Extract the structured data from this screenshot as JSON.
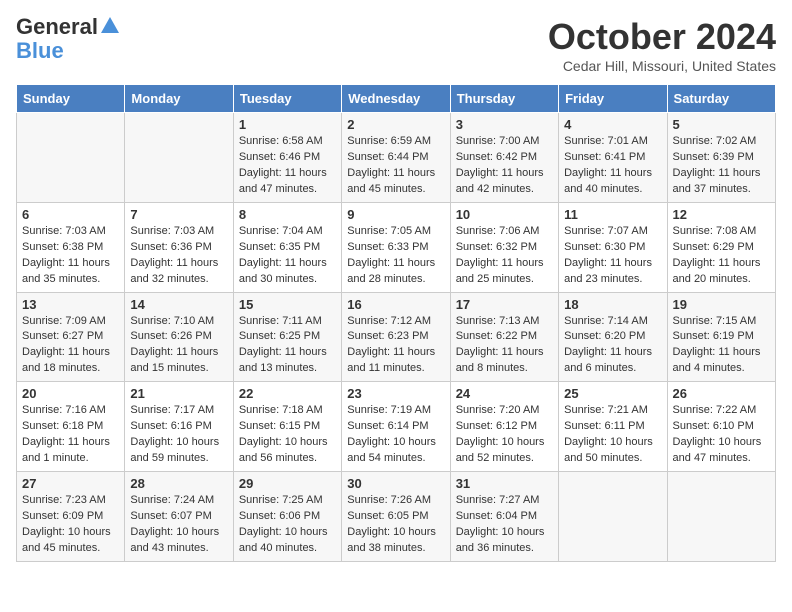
{
  "header": {
    "logo_general": "General",
    "logo_blue": "Blue",
    "month_title": "October 2024",
    "location": "Cedar Hill, Missouri, United States"
  },
  "days_of_week": [
    "Sunday",
    "Monday",
    "Tuesday",
    "Wednesday",
    "Thursday",
    "Friday",
    "Saturday"
  ],
  "weeks": [
    [
      {
        "day": "",
        "info": ""
      },
      {
        "day": "",
        "info": ""
      },
      {
        "day": "1",
        "info": "Sunrise: 6:58 AM\nSunset: 6:46 PM\nDaylight: 11 hours and 47 minutes."
      },
      {
        "day": "2",
        "info": "Sunrise: 6:59 AM\nSunset: 6:44 PM\nDaylight: 11 hours and 45 minutes."
      },
      {
        "day": "3",
        "info": "Sunrise: 7:00 AM\nSunset: 6:42 PM\nDaylight: 11 hours and 42 minutes."
      },
      {
        "day": "4",
        "info": "Sunrise: 7:01 AM\nSunset: 6:41 PM\nDaylight: 11 hours and 40 minutes."
      },
      {
        "day": "5",
        "info": "Sunrise: 7:02 AM\nSunset: 6:39 PM\nDaylight: 11 hours and 37 minutes."
      }
    ],
    [
      {
        "day": "6",
        "info": "Sunrise: 7:03 AM\nSunset: 6:38 PM\nDaylight: 11 hours and 35 minutes."
      },
      {
        "day": "7",
        "info": "Sunrise: 7:03 AM\nSunset: 6:36 PM\nDaylight: 11 hours and 32 minutes."
      },
      {
        "day": "8",
        "info": "Sunrise: 7:04 AM\nSunset: 6:35 PM\nDaylight: 11 hours and 30 minutes."
      },
      {
        "day": "9",
        "info": "Sunrise: 7:05 AM\nSunset: 6:33 PM\nDaylight: 11 hours and 28 minutes."
      },
      {
        "day": "10",
        "info": "Sunrise: 7:06 AM\nSunset: 6:32 PM\nDaylight: 11 hours and 25 minutes."
      },
      {
        "day": "11",
        "info": "Sunrise: 7:07 AM\nSunset: 6:30 PM\nDaylight: 11 hours and 23 minutes."
      },
      {
        "day": "12",
        "info": "Sunrise: 7:08 AM\nSunset: 6:29 PM\nDaylight: 11 hours and 20 minutes."
      }
    ],
    [
      {
        "day": "13",
        "info": "Sunrise: 7:09 AM\nSunset: 6:27 PM\nDaylight: 11 hours and 18 minutes."
      },
      {
        "day": "14",
        "info": "Sunrise: 7:10 AM\nSunset: 6:26 PM\nDaylight: 11 hours and 15 minutes."
      },
      {
        "day": "15",
        "info": "Sunrise: 7:11 AM\nSunset: 6:25 PM\nDaylight: 11 hours and 13 minutes."
      },
      {
        "day": "16",
        "info": "Sunrise: 7:12 AM\nSunset: 6:23 PM\nDaylight: 11 hours and 11 minutes."
      },
      {
        "day": "17",
        "info": "Sunrise: 7:13 AM\nSunset: 6:22 PM\nDaylight: 11 hours and 8 minutes."
      },
      {
        "day": "18",
        "info": "Sunrise: 7:14 AM\nSunset: 6:20 PM\nDaylight: 11 hours and 6 minutes."
      },
      {
        "day": "19",
        "info": "Sunrise: 7:15 AM\nSunset: 6:19 PM\nDaylight: 11 hours and 4 minutes."
      }
    ],
    [
      {
        "day": "20",
        "info": "Sunrise: 7:16 AM\nSunset: 6:18 PM\nDaylight: 11 hours and 1 minute."
      },
      {
        "day": "21",
        "info": "Sunrise: 7:17 AM\nSunset: 6:16 PM\nDaylight: 10 hours and 59 minutes."
      },
      {
        "day": "22",
        "info": "Sunrise: 7:18 AM\nSunset: 6:15 PM\nDaylight: 10 hours and 56 minutes."
      },
      {
        "day": "23",
        "info": "Sunrise: 7:19 AM\nSunset: 6:14 PM\nDaylight: 10 hours and 54 minutes."
      },
      {
        "day": "24",
        "info": "Sunrise: 7:20 AM\nSunset: 6:12 PM\nDaylight: 10 hours and 52 minutes."
      },
      {
        "day": "25",
        "info": "Sunrise: 7:21 AM\nSunset: 6:11 PM\nDaylight: 10 hours and 50 minutes."
      },
      {
        "day": "26",
        "info": "Sunrise: 7:22 AM\nSunset: 6:10 PM\nDaylight: 10 hours and 47 minutes."
      }
    ],
    [
      {
        "day": "27",
        "info": "Sunrise: 7:23 AM\nSunset: 6:09 PM\nDaylight: 10 hours and 45 minutes."
      },
      {
        "day": "28",
        "info": "Sunrise: 7:24 AM\nSunset: 6:07 PM\nDaylight: 10 hours and 43 minutes."
      },
      {
        "day": "29",
        "info": "Sunrise: 7:25 AM\nSunset: 6:06 PM\nDaylight: 10 hours and 40 minutes."
      },
      {
        "day": "30",
        "info": "Sunrise: 7:26 AM\nSunset: 6:05 PM\nDaylight: 10 hours and 38 minutes."
      },
      {
        "day": "31",
        "info": "Sunrise: 7:27 AM\nSunset: 6:04 PM\nDaylight: 10 hours and 36 minutes."
      },
      {
        "day": "",
        "info": ""
      },
      {
        "day": "",
        "info": ""
      }
    ]
  ]
}
